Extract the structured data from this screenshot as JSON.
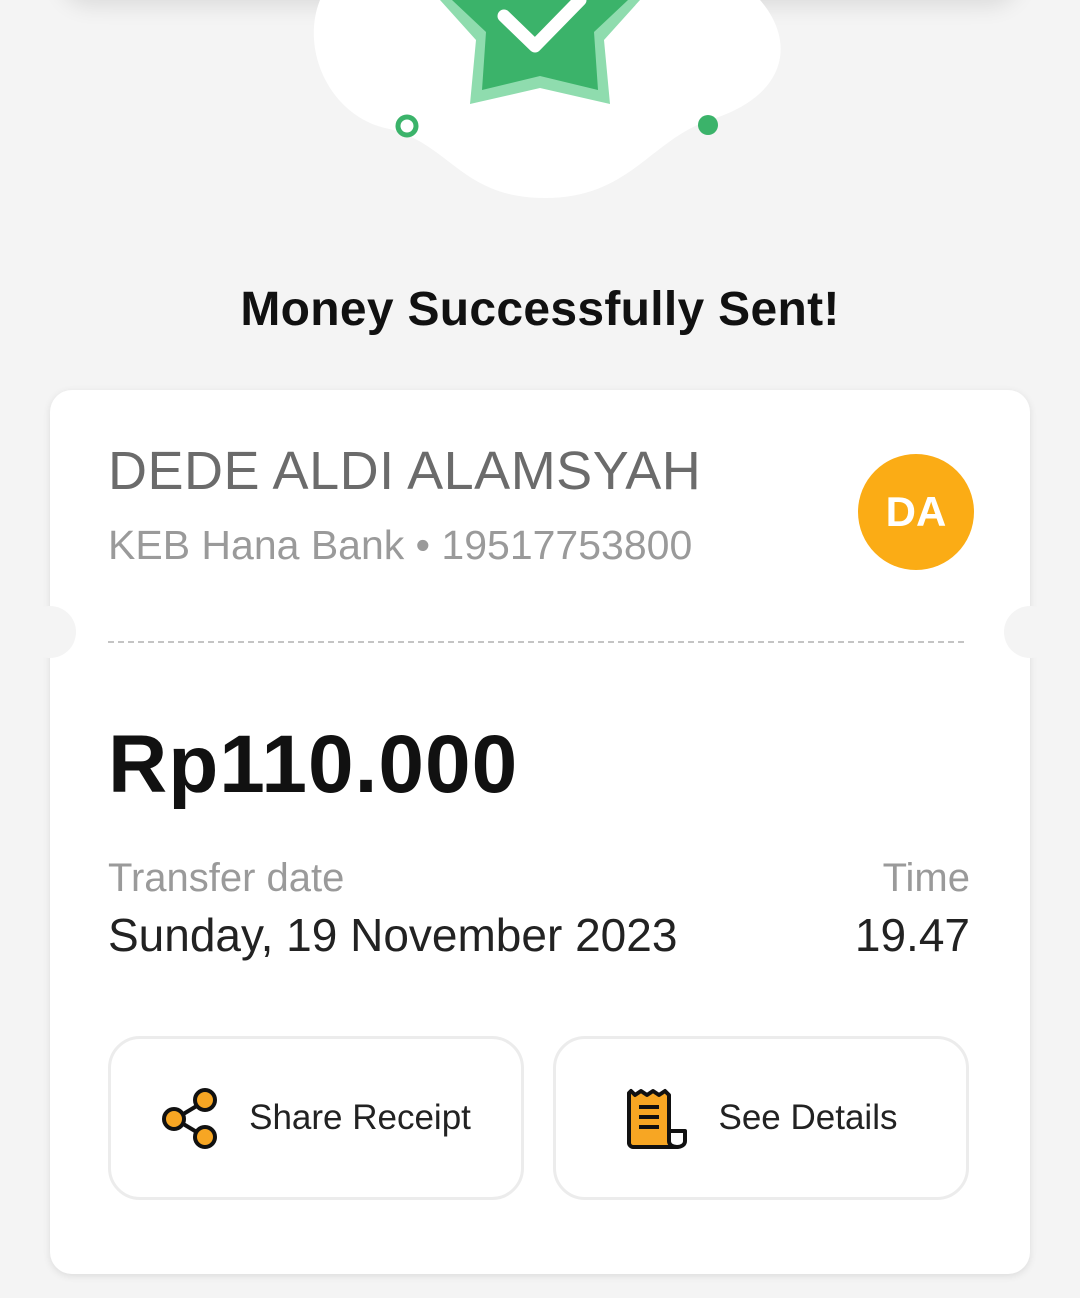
{
  "header": {
    "title": "Money Successfully Sent!"
  },
  "recipient": {
    "name": "DEDE ALDI ALAMSYAH",
    "bank_and_account": "KEB Hana Bank • 19517753800",
    "avatar_initials": "DA"
  },
  "transfer": {
    "amount": "Rp110.000",
    "date_label": "Transfer date",
    "date_value": "Sunday, 19 November 2023",
    "time_label": "Time",
    "time_value": "19.47"
  },
  "actions": {
    "share_label": "Share Receipt",
    "details_label": "See Details"
  },
  "icons": {
    "hero": "success-star-check-icon",
    "share": "share-icon",
    "details": "receipt-icon"
  },
  "colors": {
    "success_green": "#3bb36a",
    "success_green_light": "#8fdcae",
    "avatar_orange": "#fbac15",
    "icon_orange": "#f7a623",
    "background": "#f4f4f4"
  }
}
